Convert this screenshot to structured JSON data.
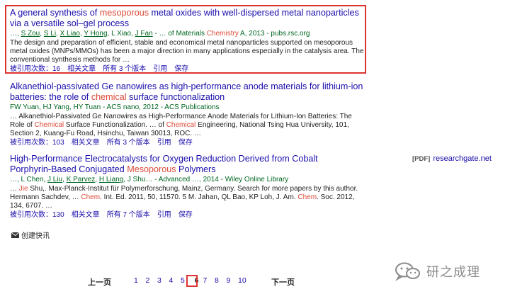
{
  "results": [
    {
      "title_parts": [
        {
          "t": "A general synthesis of ",
          "hl": false
        },
        {
          "t": "mesoporous",
          "hl": true
        },
        {
          "t": " metal oxides with well-dispersed metal nanoparticles via a versatile sol–gel process",
          "hl": false
        }
      ],
      "meta_parts": [
        {
          "t": "…, ",
          "c": ""
        },
        {
          "t": "S Zou",
          "c": "au"
        },
        {
          "t": ", ",
          "c": ""
        },
        {
          "t": "S Li",
          "c": "au"
        },
        {
          "t": ", ",
          "c": ""
        },
        {
          "t": "X Liao",
          "c": "au"
        },
        {
          "t": ", ",
          "c": ""
        },
        {
          "t": "Y Hong",
          "c": "au"
        },
        {
          "t": ", L Xiao, ",
          "c": ""
        },
        {
          "t": "J Fan",
          "c": "au"
        },
        {
          "t": " - … of Materials ",
          "c": ""
        },
        {
          "t": "Chemistry",
          "c": "hl"
        },
        {
          "t": " A, 2013 - pubs.rsc.org",
          "c": ""
        }
      ],
      "snippet_parts": [
        {
          "t": "The design and preparation of efficient, stable and economical metal nanoparticles supported on mesoporous metal oxides (MNPs/MMOs) has been a major direction in many applications especially in the catalysis area. The conventional synthesis methods for …",
          "hl": false
        }
      ],
      "links": [
        "被引用次数：16",
        "相关文章",
        "所有 3 个版本",
        "引用",
        "保存"
      ]
    },
    {
      "title_parts": [
        {
          "t": "Alkanethiol-passivated Ge nanowires as high-performance anode materials for lithium-ion batteries: the role of ",
          "hl": false
        },
        {
          "t": "chemical",
          "hl": true
        },
        {
          "t": " surface functionalization",
          "hl": false
        }
      ],
      "meta_parts": [
        {
          "t": "FW Yuan, HJ Yang, HY Tuan - ACS nano, 2012 - ACS Publications",
          "c": ""
        }
      ],
      "snippet_parts": [
        {
          "t": "… Alkanethiol-Passivated Ge Nanowires as High-Performance Anode Materials for Lithium-Ion Batteries: The Role of ",
          "hl": false
        },
        {
          "t": "Chemical",
          "hl": true
        },
        {
          "t": " Surface Functionalization. … of ",
          "hl": false
        },
        {
          "t": "Chemical",
          "hl": true
        },
        {
          "t": " Engineering, National Tsing Hua University, 101, Section 2, Kuang-Fu Road, Hsinchu, Taiwan 30013, ROC. …",
          "hl": false
        }
      ],
      "links": [
        "被引用次数：103",
        "相关文章",
        "所有 3 个版本",
        "引用",
        "保存"
      ]
    },
    {
      "title_parts": [
        {
          "t": "High‑Performance Electrocatalysts for Oxygen Reduction Derived from Cobalt Porphyrin‑Based Conjugated ",
          "hl": false
        },
        {
          "t": "Mesoporous",
          "hl": true
        },
        {
          "t": " Polymers",
          "hl": false
        }
      ],
      "meta_parts": [
        {
          "t": "…, L Chen, ",
          "c": ""
        },
        {
          "t": "J Liu",
          "c": "au"
        },
        {
          "t": ", ",
          "c": ""
        },
        {
          "t": "K Parvez",
          "c": "au"
        },
        {
          "t": ", ",
          "c": ""
        },
        {
          "t": "H Liang",
          "c": "au"
        },
        {
          "t": ", J Shu… - Advanced …, 2014 - Wiley Online Library",
          "c": ""
        }
      ],
      "snippet_parts": [
        {
          "t": "… ",
          "hl": false
        },
        {
          "t": "Jie",
          "hl": true
        },
        {
          "t": " Shu,. Max-Planck-Institut für Polymerforschung, Mainz, Germany. Search for more papers by this author. Hermann Sachdev, … ",
          "hl": false
        },
        {
          "t": "Chem",
          "hl": true
        },
        {
          "t": ". Int. Ed. 2011, 50, 11570. 5 M. Jahan, QL Bao, KP Loh, J. Am. ",
          "hl": false
        },
        {
          "t": "Chem",
          "hl": true
        },
        {
          "t": ". Soc. 2012, 134, 6707. …",
          "hl": false
        }
      ],
      "links": [
        "被引用次数：130",
        "相关文章",
        "所有 7 个版本",
        "引用",
        "保存"
      ]
    }
  ],
  "pdf_side": {
    "tag": "[PDF]",
    "domain": "researchgate.net"
  },
  "alert_label": "创建快讯",
  "pagination": {
    "prev": "上一页",
    "next": "下一页",
    "pages": [
      "1",
      "2",
      "3",
      "4",
      "5",
      "6",
      "7",
      "8",
      "9",
      "10"
    ],
    "current": "6"
  },
  "watermark_text": "研之成理",
  "colors": {
    "link": "#1a0dab",
    "highlight": "#dd4b39",
    "meta": "#006621",
    "box": "#dd3333"
  }
}
